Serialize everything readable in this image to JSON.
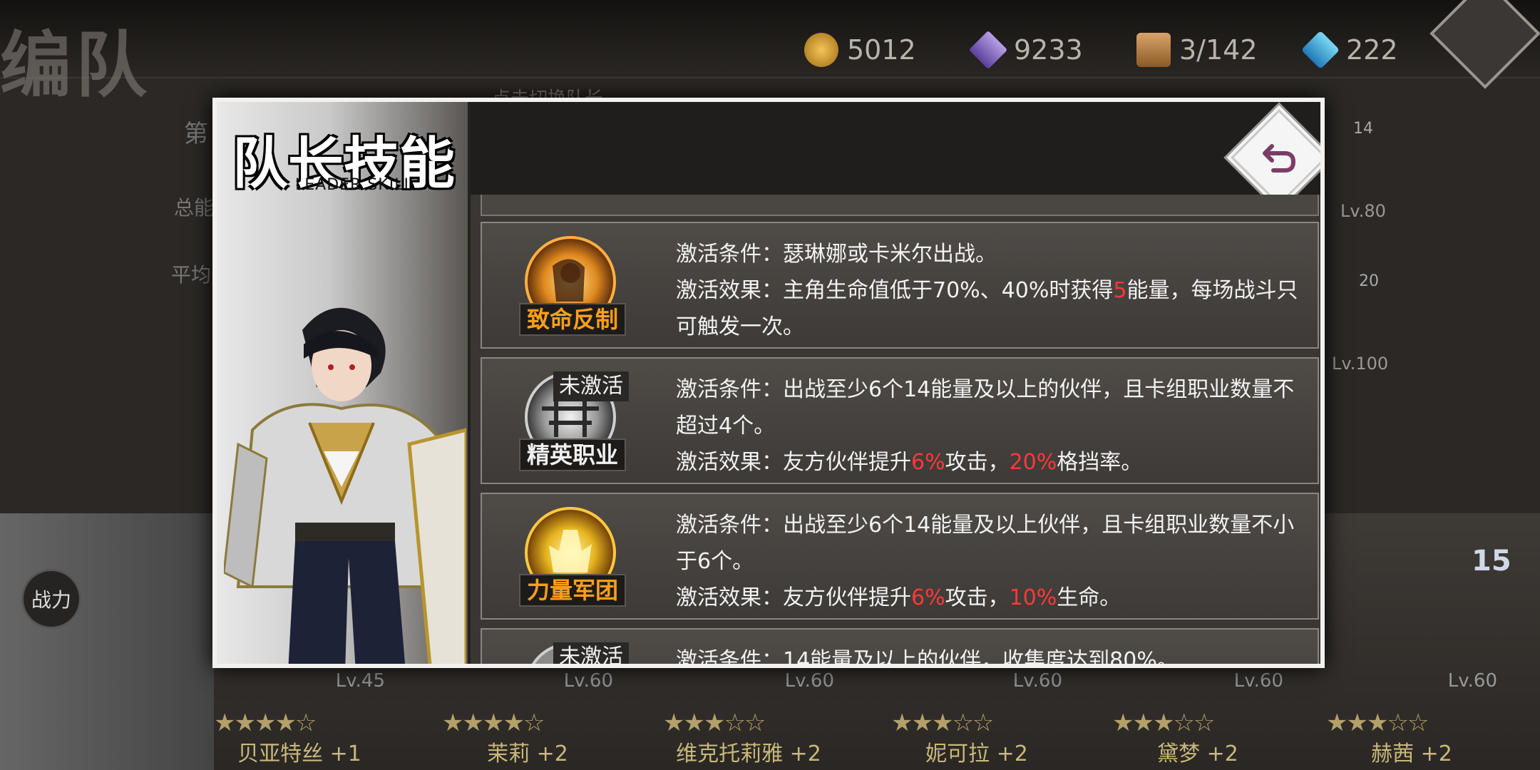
{
  "page": {
    "title": "编队"
  },
  "resources": [
    {
      "icon": "gold-coin-icon",
      "value": "5012"
    },
    {
      "icon": "crystal-icon",
      "value": "9233"
    },
    {
      "icon": "chest-icon",
      "value": "3/142"
    },
    {
      "icon": "diamond-gem-icon",
      "value": "222"
    }
  ],
  "background": {
    "tip": "点击切换队长",
    "label_1": "第",
    "label_2": "总能",
    "label_3": "平均",
    "power_button": "战力",
    "side_levels": [
      "14",
      "Lv.80",
      "20",
      "Lv.100"
    ],
    "badge_15": "15",
    "cards": [
      {
        "name": "贝亚特丝 +1",
        "level": "Lv.45",
        "stars": 4
      },
      {
        "name": "茉莉 +2",
        "level": "Lv.60",
        "stars": 4
      },
      {
        "name": "维克托莉雅 +2",
        "level": "Lv.60",
        "stars": 3
      },
      {
        "name": "妮可拉 +2",
        "level": "Lv.60",
        "stars": 3
      },
      {
        "name": "黛梦 +2",
        "level": "Lv.60",
        "stars": 3
      },
      {
        "name": "赫茜 +2",
        "level": "Lv.60",
        "stars": 3
      }
    ]
  },
  "modal": {
    "title": "队长技能",
    "subtitle": "LEADER SKILL",
    "skills": [
      {
        "name": "致命反制",
        "active": true,
        "condition_label": "激活条件：",
        "condition": "瑟琳娜或卡米尔出战。",
        "effect_label": "激活效果：",
        "effect_parts": [
          "主角生命值低于70%、40%时获得",
          "5",
          "能量，每场战斗只可触发一次。"
        ]
      },
      {
        "name": "精英职业",
        "active": false,
        "inactive_label": "未激活",
        "condition_label": "激活条件：",
        "condition": "出战至少6个14能量及以上的伙伴，且卡组职业数量不超过4个。",
        "effect_label": "激活效果：",
        "effect_parts": [
          "友方伙伴提升",
          "6%",
          "攻击，",
          "20%",
          "格挡率。"
        ]
      },
      {
        "name": "力量军团",
        "active": true,
        "condition_label": "激活条件：",
        "condition": "出战至少6个14能量及以上伙伴，且卡组职业数量不小于6个。",
        "effect_label": "激活效果：",
        "effect_parts": [
          "友方伙伴提升",
          "6%",
          "攻击，",
          "10%",
          "生命。"
        ]
      },
      {
        "name": "",
        "active": false,
        "inactive_label": "未激活",
        "condition_label": "激活条件：",
        "condition": "14能量及以上的伙伴，收集度达到80%。"
      }
    ]
  }
}
